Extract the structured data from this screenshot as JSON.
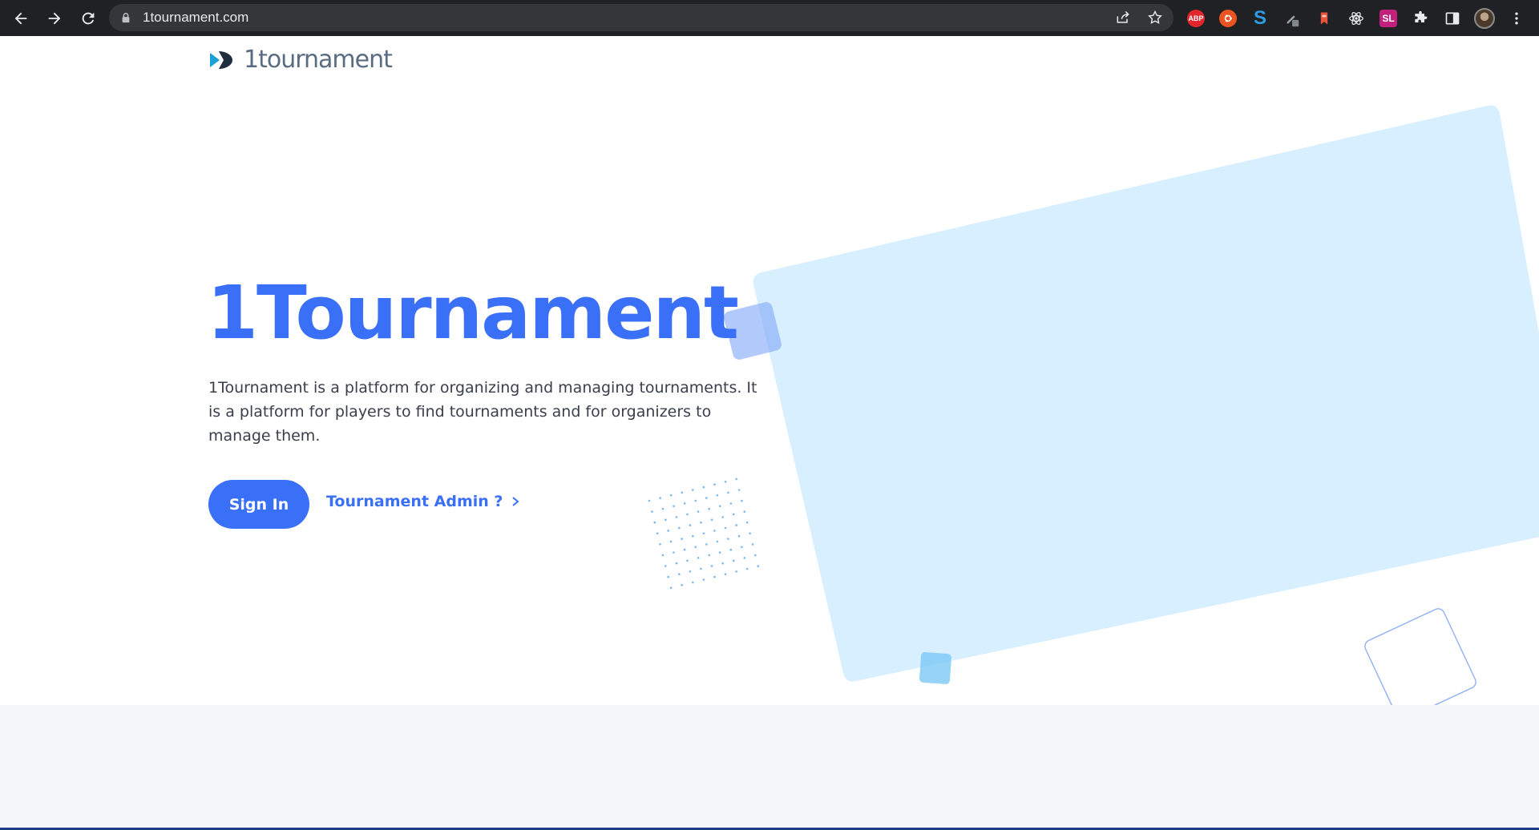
{
  "browser": {
    "url": "1tournament.com",
    "icons": {
      "back": "back-arrow-icon",
      "forward": "forward-arrow-icon",
      "reload": "reload-icon",
      "lock": "lock-icon",
      "share": "share-icon",
      "bookmark": "star-icon"
    },
    "extensions": [
      {
        "name": "adblock-plus-extension",
        "label": "ABP",
        "color": "#e3262c"
      },
      {
        "name": "ubuntu-extension",
        "label": "",
        "color": "#e95420"
      },
      {
        "name": "s-extension",
        "label": "S",
        "color": "#2d9be2"
      },
      {
        "name": "pen-extension",
        "label": "",
        "color": "#9aa0a6"
      },
      {
        "name": "bookmark-extension",
        "label": "",
        "color": "#e8543a"
      },
      {
        "name": "react-devtools-extension",
        "label": "",
        "color": "#e8eaed"
      },
      {
        "name": "sl-extension",
        "label": "SL",
        "color": "#c2207d"
      },
      {
        "name": "puzzle-extension",
        "label": "",
        "color": "#e8eaed"
      },
      {
        "name": "side-panel-extension",
        "label": "",
        "color": "#e8eaed"
      }
    ]
  },
  "header": {
    "brand_name": "1tournament"
  },
  "hero": {
    "title": "1Tournament",
    "description": "1Tournament is a platform for organizing and managing tournaments. It is a platform for players to find tournaments and for organizers to manage them.",
    "signin_label": "Sign In",
    "admin_label": "Tournament Admin ?"
  },
  "colors": {
    "accent": "#3a6ff7",
    "shape_fill": "#d8efff",
    "chrome_bg": "#202124"
  }
}
